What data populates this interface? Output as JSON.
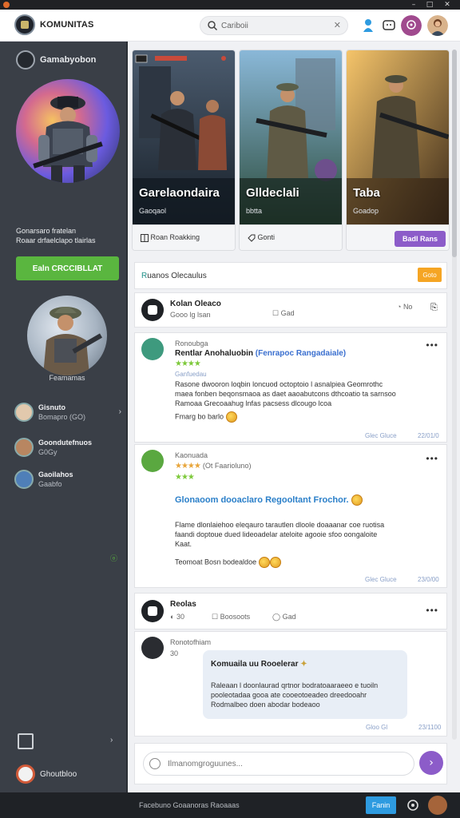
{
  "window": {
    "minimize": "–",
    "maximize": "□",
    "close": "✕"
  },
  "header": {
    "brand": "KOMUNITAS",
    "search_value": "Cariboii",
    "search_clear": "✕"
  },
  "sidebar": {
    "title": "Gamabyobon",
    "subtitle_line1": "Gonarsaro fratelan",
    "subtitle_line2": "Roaar drfaelclapo tlairlas",
    "cta_label": "Ealn CRCCIBLLAT",
    "soldier_name": "Feamamas",
    "friends": [
      {
        "name": "Gisnuto",
        "status": "Bomapro (GO)"
      },
      {
        "name": "Goondutefnuos",
        "status": "G0Gy"
      },
      {
        "name": "Gaoilahos",
        "status": "Gaabfo"
      }
    ],
    "handle": "ⓞ",
    "user_name": "Ghoutbloo"
  },
  "cards": [
    {
      "title": "Garelaondaira",
      "subtitle": "Gaoqaol"
    },
    {
      "title": "Glldeclali",
      "subtitle": "bbtta"
    },
    {
      "title": "Taba",
      "subtitle": "Goadop"
    }
  ],
  "card_actions": {
    "card1": "Roan Roakking",
    "card2": "Gonti",
    "card3_button": "Badl Rans"
  },
  "section": {
    "title_prefix": "R",
    "title_rest": "uanos Olecaulus",
    "button": "Goto"
  },
  "post_header": {
    "name": "Kolan Oleaco",
    "meta": "Gooo lg lsan",
    "action_label": "Gad",
    "count": "No"
  },
  "posts": [
    {
      "author": "Ronoubga",
      "title": "Rentlar Anohaluobin",
      "title_tag": "(Fenrapoc Rangadaiale)",
      "stars": "★★★★",
      "sub_label": "Ganfuedau",
      "body_line1": "Rasone dwooron loqbin loncuod octoptoio l asnalpiea Geomrothc",
      "body_line2": "maea fonben beqonsmaoa as daet aaoabutcons dthcoatio ta sarnsoo",
      "body_line3": "Ramoaa Grecoaahug lnfas pacsess dlcougo lcoa",
      "body_line4": "Fmarg bo barlo",
      "meta_left": "Glec Gluce",
      "meta_right": "22/01/0"
    },
    {
      "author": "Kaonuada",
      "stars": "★★★★",
      "rating_note": "(Ot Faarioluno)",
      "sub_stars": "★★★",
      "headline": "Glonaoom dooaclaro Regooltant Frochor.",
      "body_line1": "Flame dlonlaiehoo eleqauro tarautlen dloole doaaanar coe ruotisa",
      "body_line2": "faandi doptoue dued lideoadelar ateloite agooie sfoo oongaloite",
      "body_line3": "Kaat.",
      "body_line4": "Teomoat Bosn bodealdoe",
      "meta_left": "Glec Gluce",
      "meta_right": "23/0/00"
    }
  ],
  "thread": {
    "name": "Reolas",
    "count1": "30",
    "action2": "Boosoots",
    "action3": "Gad"
  },
  "chat": {
    "author": "Ronotofhiam",
    "time": "30",
    "bubble_title": "Komuaila  uu Rooelerar",
    "bubble_body1": "Raleaan l doonlaurad qrtnor bodratoaaraeeo e tuoiln",
    "bubble_body2": "pooleotadaa gooa ate cooeotoeadeo dreedooahr",
    "bubble_body3": "Rodmalbeo doen abodar bodeaoo",
    "meta_left": "Gloo Gl",
    "meta_right": "23/1100"
  },
  "composer": {
    "placeholder": "Ilmanomgroguunes..."
  },
  "footer": {
    "text": "Facebuno Goaanoras Raoaaas",
    "button": "Fanin"
  },
  "colors": {
    "accent_green": "#5ab63f",
    "accent_purple": "#8c5cc9",
    "accent_orange": "#f5a524",
    "sidebar_bg": "#3a3f47",
    "footer_blue": "#2e9be0"
  }
}
